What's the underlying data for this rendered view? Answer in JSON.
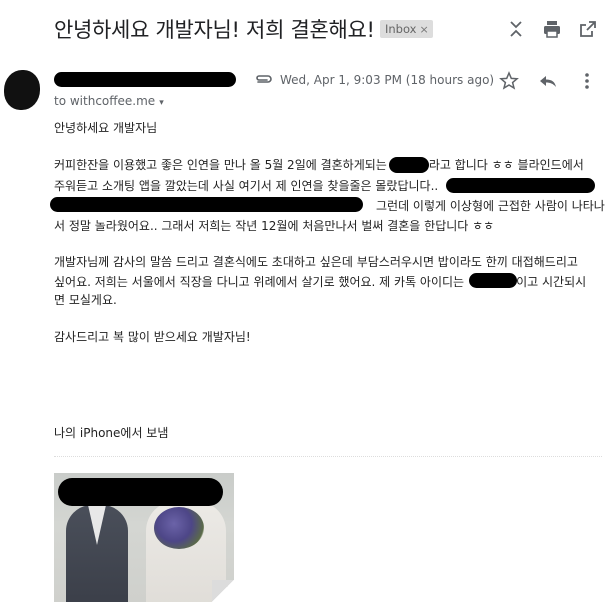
{
  "subject": "안녕하세요 개발자님! 저희 결혼해요!",
  "label_badge": {
    "text": "Inbox",
    "close": "×"
  },
  "toolbar_icons": [
    "collapse-expand-icon",
    "print-icon",
    "open-new-window-icon"
  ],
  "header": {
    "date": "Wed, Apr 1, 9:03 PM (18 hours ago)",
    "to_text": "to withcoffee.me",
    "to_caret": "▾",
    "action_icons": [
      "star-icon",
      "reply-icon",
      "more-vertical-icon"
    ]
  },
  "body": {
    "greeting": "안녕하세요 개발자님",
    "p1_l1a": "커피한잔을 이용했고 좋은 인연을 만나 올 5월 2일에 결혼하게되는",
    "p1_l1b": "라고 합니다 ㅎㅎ 블라인드에서",
    "p1_l2": "주워듣고 소개팅 앱을 깔았는데 사실 여기서 제 인연을 찾을줄은 몰랐답니다..",
    "p1_l3": "그런데 이렇게 이상형에 근접한 사람이 나타나",
    "p1_l4": "서 정말 놀라웠어요.. 그래서 저희는 작년 12월에 처음만나서 벌써 결혼을 한답니다 ㅎㅎ",
    "p2_l1": "개발자님께 감사의 말씀 드리고 결혼식에도 초대하고 싶은데 부담스러우시면 밥이라도 한끼 대접해드리고",
    "p2_l2a": "싶어요. 저희는 서울에서 직장을 다니고 위례에서 살기로 했어요. 제 카톡 아이디는",
    "p2_l2b": "이고 시간되시",
    "p2_l3": "면 모실게요.",
    "closing": "감사드리고 복 많이 받으세요 개발자님!",
    "signature": "나의 iPhone에서 보냄"
  }
}
